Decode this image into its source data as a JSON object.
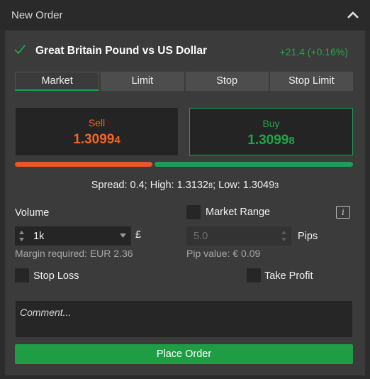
{
  "window": {
    "title": "New Order"
  },
  "instrument": {
    "name": "Great Britain Pound vs US Dollar",
    "change": "+21.4 (+0.16%)"
  },
  "tabs": [
    {
      "label": "Market",
      "active": true
    },
    {
      "label": "Limit",
      "active": false
    },
    {
      "label": "Stop",
      "active": false
    },
    {
      "label": "Stop Limit",
      "active": false
    }
  ],
  "sell": {
    "label": "Sell",
    "price_main": "1.3099",
    "price_pip": "4"
  },
  "buy": {
    "label": "Buy",
    "price_main": "1.3099",
    "price_pip": "8"
  },
  "sentiment": {
    "sell_fraction": 0.41,
    "buy_fraction": 0.59
  },
  "spread": {
    "spread_text": "Spread: 0.4; High: 1.3132",
    "high_pip": "8",
    "low_text": "; Low: 1.3049",
    "low_pip": "3"
  },
  "volume": {
    "label": "Volume",
    "value": "1k",
    "currency": "£",
    "margin": "Margin required: EUR 2.36"
  },
  "market_range": {
    "label": "Market Range",
    "checked": false
  },
  "pips": {
    "value": "5.0",
    "label": "Pips",
    "pip_value": "Pip value: € 0.09"
  },
  "stop_loss": {
    "label": "Stop Loss",
    "checked": false
  },
  "take_profit": {
    "label": "Take Profit",
    "checked": false
  },
  "comment": {
    "placeholder": "Comment..."
  },
  "place_order": {
    "label": "Place Order"
  },
  "colors": {
    "sell": "#f26522",
    "buy": "#22a447",
    "accent": "#1f9d55"
  },
  "icons": {
    "check": "check-icon",
    "collapse": "chevron-up-icon",
    "info": "info-icon"
  }
}
